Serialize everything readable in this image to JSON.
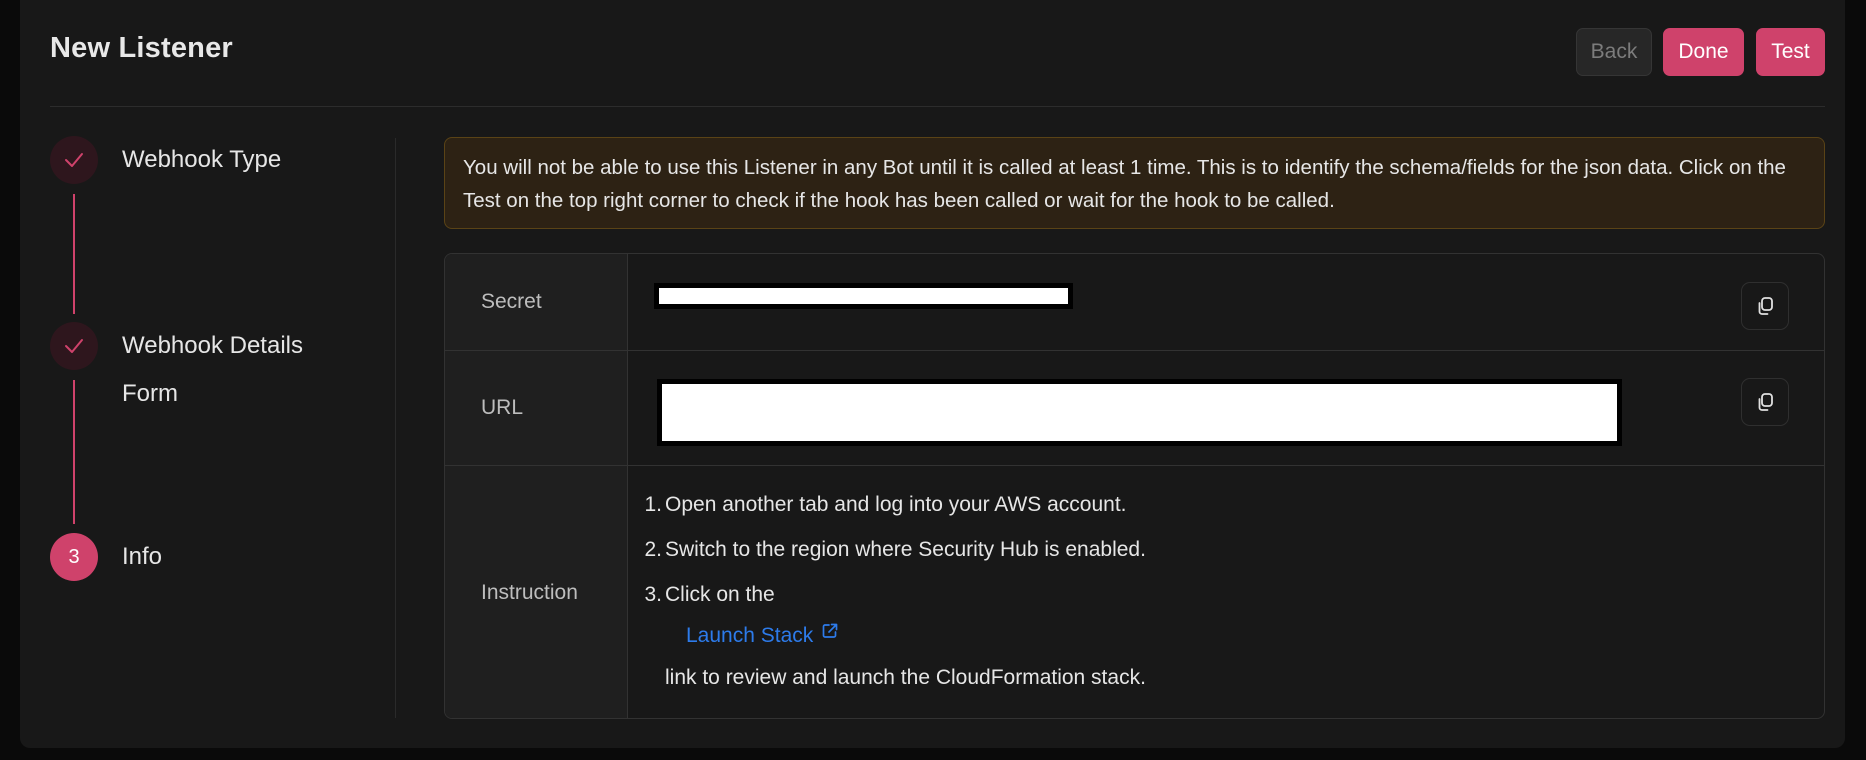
{
  "header": {
    "title": "New Listener",
    "buttons": {
      "back": "Back",
      "done": "Done",
      "test": "Test"
    }
  },
  "stepper": {
    "steps": [
      {
        "label": "Webhook Type",
        "status": "completed",
        "icon": "check-icon"
      },
      {
        "label_line1": "Webhook Details",
        "label_line2": "Form",
        "status": "completed",
        "icon": "check-icon"
      },
      {
        "label": "Info",
        "status": "active",
        "number": "3"
      }
    ]
  },
  "alert": {
    "text": "You will not be able to use this Listener in any Bot until it is called at least 1 time. This is to identify the schema/fields for the json data. Click on the Test on the top right corner to check if the hook has been called or wait for the hook to be called."
  },
  "details": {
    "rows": [
      {
        "label": "Secret",
        "value": "[redacted]",
        "copy_icon": "copy-icon"
      },
      {
        "label": "URL",
        "value": "[redacted]",
        "copy_icon": "copy-icon"
      },
      {
        "label": "Instruction"
      }
    ],
    "instructions": {
      "step1_num": "1.",
      "step1": "Open another tab and log into your AWS account.",
      "step2_num": "2.",
      "step2": "Switch to the region where Security Hub is enabled.",
      "step3_num": "3.",
      "step3": "Click on the",
      "link_label": "Launch Stack",
      "link_icon": "external-link-icon",
      "step3_cont": "link to review and launch the CloudFormation stack."
    }
  },
  "colors": {
    "accent": "#cf426b",
    "link": "#2d7bea",
    "alert_bg": "#2d2214",
    "alert_border": "#5a4316",
    "panel_bg": "#181818"
  }
}
